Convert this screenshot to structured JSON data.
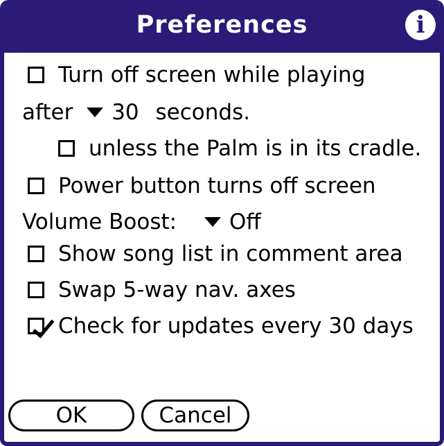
{
  "window": {
    "title": "Preferences",
    "info_icon": "info-icon"
  },
  "options": {
    "turn_off_screen": {
      "label": "Turn off screen while playing",
      "checked": false
    },
    "after_prefix": "after",
    "after_value": "30",
    "after_suffix": "seconds.",
    "unless_cradle": {
      "label": "unless the Palm is in its cradle.",
      "checked": false
    },
    "power_button": {
      "label": "Power button turns off screen",
      "checked": false
    },
    "volume_boost_label": "Volume Boost:",
    "volume_boost_value": "Off",
    "show_song_list": {
      "label": "Show song list in comment area",
      "checked": false
    },
    "swap_axes": {
      "label": "Swap 5-way nav. axes",
      "checked": false
    },
    "check_updates": {
      "label": "Check for updates every 30 days",
      "checked": true
    }
  },
  "buttons": {
    "ok": "OK",
    "cancel": "Cancel"
  },
  "colors": {
    "titlebar": "#2b1a78",
    "background": "#ffffff",
    "text": "#000000"
  }
}
